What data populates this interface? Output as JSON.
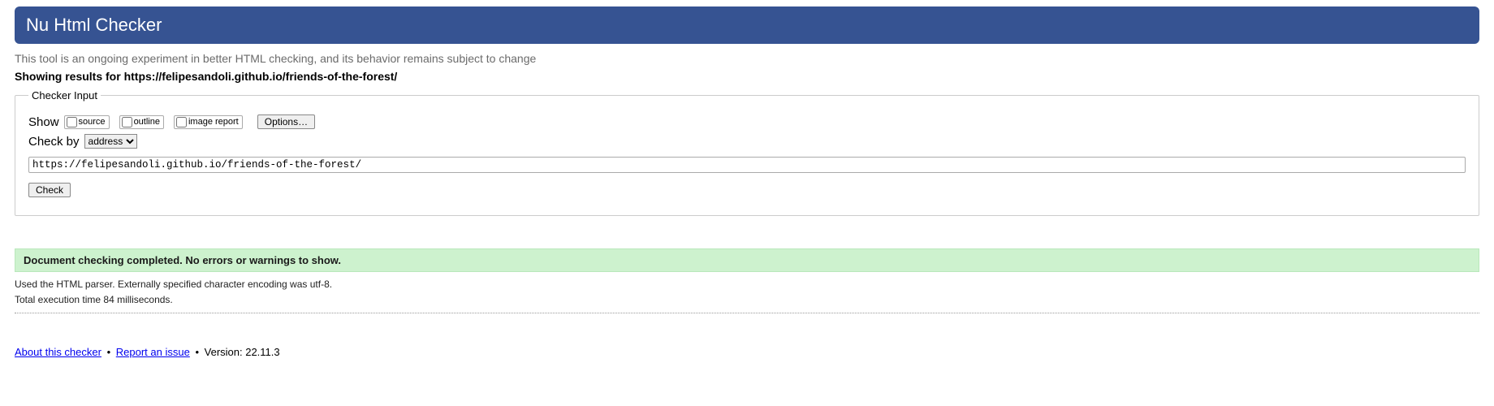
{
  "header": {
    "title": "Nu Html Checker"
  },
  "tagline": "This tool is an ongoing experiment in better HTML checking, and its behavior remains subject to change",
  "results_heading": "Showing results for https://felipesandoli.github.io/friends-of-the-forest/",
  "fieldset": {
    "legend": "Checker Input",
    "show_label": "Show",
    "source_label": "source",
    "outline_label": "outline",
    "image_report_label": "image report",
    "options_label": "Options…",
    "check_by_label": "Check by",
    "check_by_selected": "address",
    "url_value": "https://felipesandoli.github.io/friends-of-the-forest/",
    "check_button": "Check"
  },
  "success_message": "Document checking completed. No errors or warnings to show.",
  "parser_info": "Used the HTML parser. Externally specified character encoding was utf-8.",
  "timing_info": "Total execution time 84 milliseconds.",
  "footer": {
    "about_link": "About this checker",
    "report_link": "Report an issue",
    "version_label": "Version: 22.11.3"
  }
}
